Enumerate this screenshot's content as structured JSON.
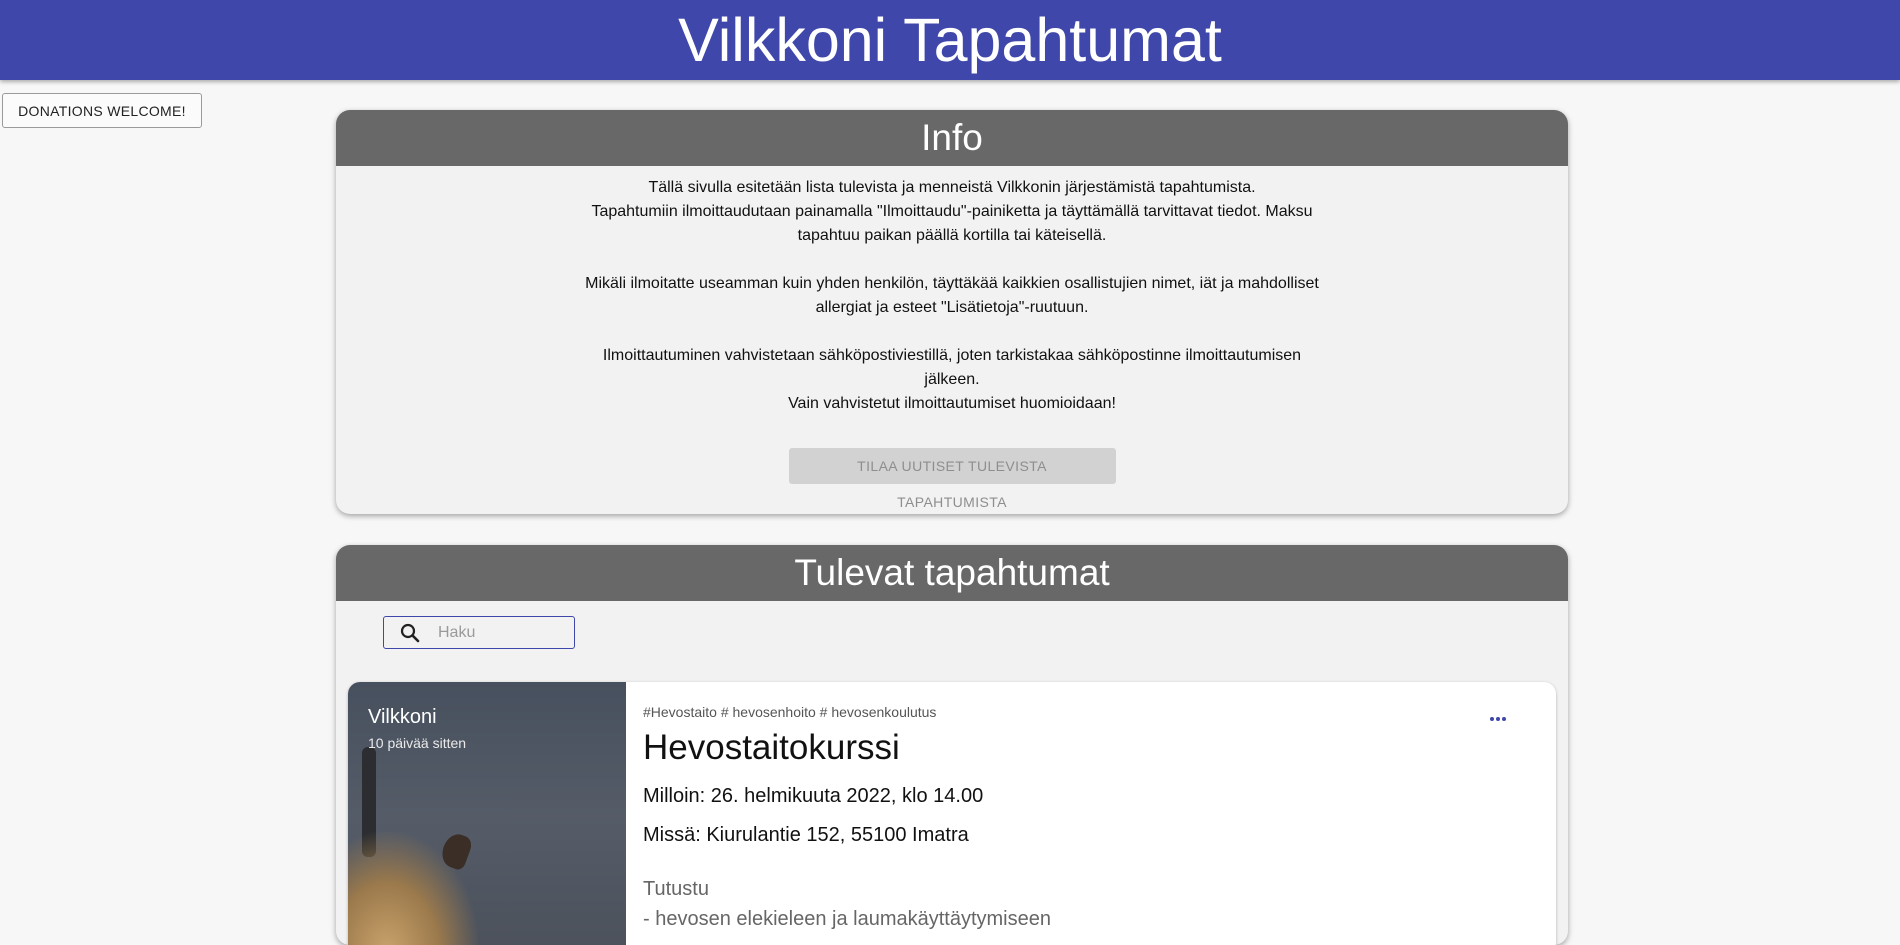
{
  "header": {
    "title": "Vilkkoni Tapahtumat"
  },
  "donate": {
    "label": "DONATIONS WELCOME!"
  },
  "info": {
    "heading": "Info",
    "line1": "Tällä sivulla esitetään lista tulevista ja menneistä Vilkkonin järjestämistä tapahtumista.",
    "line2": "Tapahtumiin ilmoittaudutaan painamalla \"Ilmoittaudu\"-painiketta ja täyttämällä tarvittavat tiedot. Maksu tapahtuu paikan päällä kortilla tai käteisellä.",
    "line3": "Mikäli ilmoitatte useamman kuin yhden henkilön, täyttäkää kaikkien osallistujien nimet, iät ja mahdolliset allergiat ja esteet \"Lisätietoja\"-ruutuun.",
    "line4": "Ilmoittautuminen vahvistetaan sähköpostiviestillä, joten tarkistakaa sähköpostinne ilmoittautumisen jälkeen.",
    "line5": "Vain vahvistetut ilmoittautumiset huomioidaan!",
    "subscribe_label": "TILAA UUTISET TULEVISTA TAPAHTUMISTA"
  },
  "events": {
    "heading": "Tulevat tapahtumat",
    "search_placeholder": "Haku",
    "search_icon": "search-icon",
    "items": [
      {
        "organizer": "Vilkkoni",
        "posted": "10 päivää sitten",
        "tags": "#Hevostaito # hevosenhoito # hevosenkoulutus",
        "title": "Hevostaitokurssi",
        "when": "Milloin: 26. helmikuuta 2022, klo 14.00",
        "where": "Missä: Kiurulantie 152, 55100 Imatra",
        "desc1": "Tutustu",
        "desc2": "- hevosen elekieleen ja laumakäyttäytymiseen"
      }
    ]
  },
  "colors": {
    "accent": "#3f48aa",
    "card_header": "#686868",
    "card_bg": "#f2f2f2"
  }
}
